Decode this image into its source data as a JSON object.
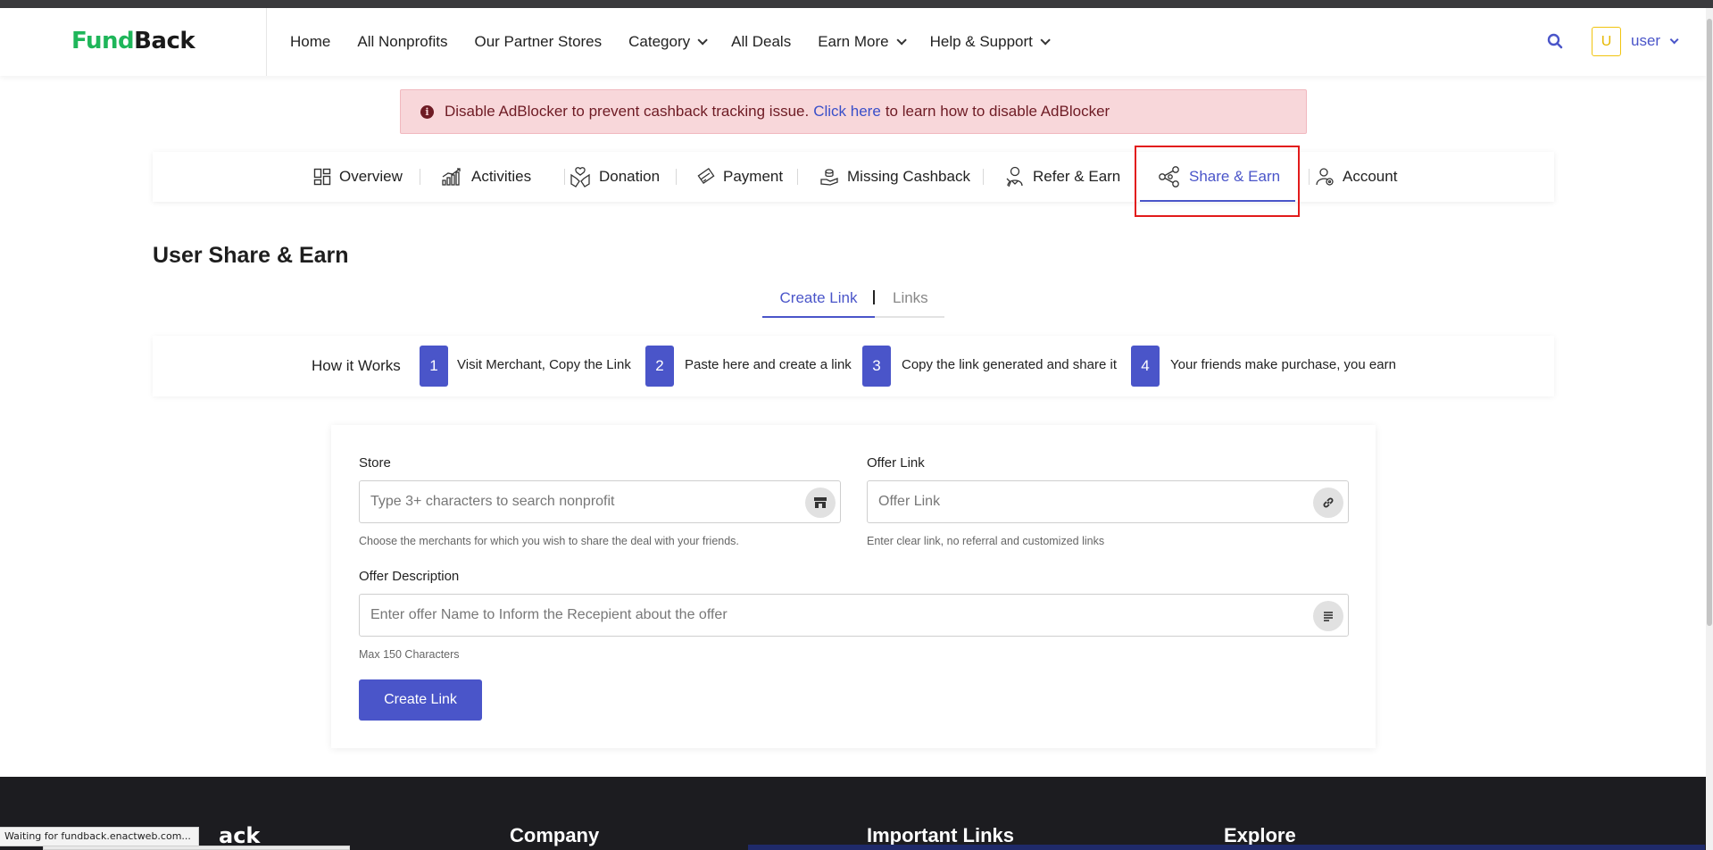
{
  "header": {
    "logo_part1": "Fund",
    "logo_part2": "Back",
    "nav": [
      {
        "label": "Home",
        "dropdown": false
      },
      {
        "label": "All Nonprofits",
        "dropdown": false
      },
      {
        "label": "Our Partner Stores",
        "dropdown": false
      },
      {
        "label": "Category",
        "dropdown": true
      },
      {
        "label": "All Deals",
        "dropdown": false
      },
      {
        "label": "Earn More",
        "dropdown": true
      },
      {
        "label": "Help & Support",
        "dropdown": true
      }
    ],
    "search_icon": "search-icon",
    "avatar_initial": "U",
    "username": "user"
  },
  "alert": {
    "text_before": "Disable AdBlocker to prevent cashback tracking issue.",
    "link_text": "Click here",
    "text_after": "to learn how to disable AdBlocker"
  },
  "dashboard_tabs": [
    {
      "label": "Overview",
      "icon": "grid-icon",
      "active": false
    },
    {
      "label": "Activities",
      "icon": "chart-icon",
      "active": false
    },
    {
      "label": "Donation",
      "icon": "donation-icon",
      "active": false
    },
    {
      "label": "Payment",
      "icon": "card-icon",
      "active": false
    },
    {
      "label": "Missing Cashback",
      "icon": "cashback-icon",
      "active": false
    },
    {
      "label": "Refer & Earn",
      "icon": "refer-icon",
      "active": false
    },
    {
      "label": "Share & Earn",
      "icon": "share-icon",
      "active": true
    },
    {
      "label": "Account",
      "icon": "account-icon",
      "active": false
    }
  ],
  "page_title": "User Share & Earn",
  "subtabs": {
    "create": "Create Link",
    "links": "Links"
  },
  "how_it_works": {
    "label": "How it Works",
    "steps": [
      {
        "num": "1",
        "text": "Visit Merchant, Copy the Link"
      },
      {
        "num": "2",
        "text": "Paste here and create a link"
      },
      {
        "num": "3",
        "text": "Copy the link generated and share it"
      },
      {
        "num": "4",
        "text": "Your friends make purchase, you earn"
      }
    ]
  },
  "form": {
    "store_label": "Store",
    "store_placeholder": "Type 3+ characters to search nonprofit",
    "store_hint": "Choose the merchants for which you wish to share the deal with your friends.",
    "offer_link_label": "Offer Link",
    "offer_link_placeholder": "Offer Link",
    "offer_link_hint": "Enter clear link, no referral and customized links",
    "desc_label": "Offer Description",
    "desc_placeholder": "Enter offer Name to Inform the Recepient about the offer",
    "desc_hint": "Max 150 Characters",
    "submit_label": "Create Link"
  },
  "footer": {
    "logo_fragment": "ack",
    "columns": [
      "Company",
      "Important Links",
      "Explore"
    ]
  },
  "browser_status": "Waiting for fundback.enactweb.com...",
  "colors": {
    "accent": "#4a55c9",
    "brand_green": "#1fb65a",
    "alert_bg": "#f8d7da",
    "highlight_red": "#e21b1b",
    "footer_bg": "#1c1c20"
  }
}
